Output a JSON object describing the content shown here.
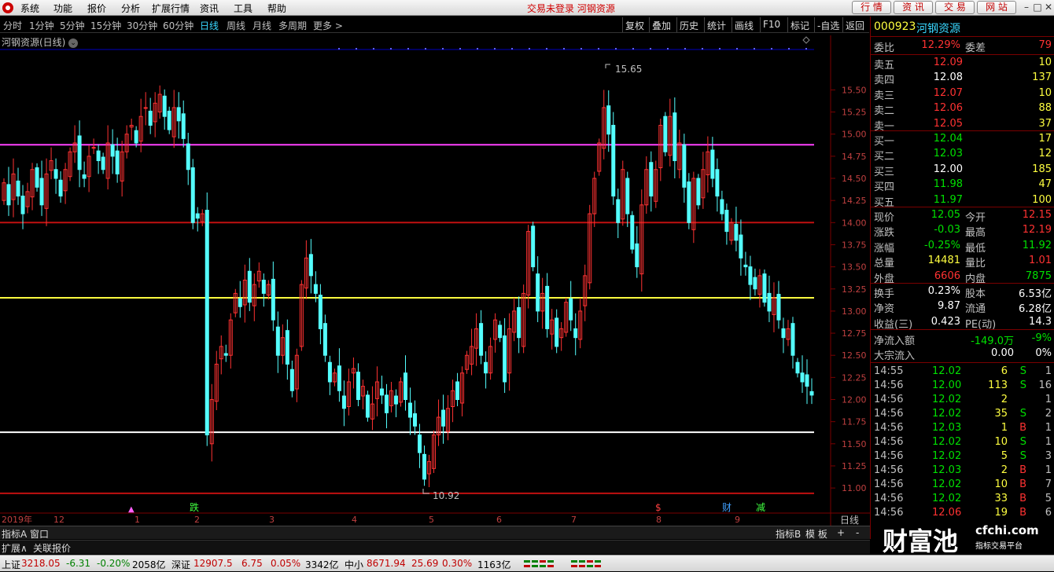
{
  "titlebar": {
    "menus": [
      "系统",
      "功能",
      "报价",
      "分析",
      "扩展行情",
      "资讯",
      "工具",
      "帮助"
    ],
    "center_text": "交易未登录  河钢资源",
    "buttons": [
      "行 情",
      "资 讯",
      "交 易",
      "网 站"
    ]
  },
  "periods": [
    "分时",
    "1分钟",
    "5分钟",
    "15分钟",
    "30分钟",
    "60分钟",
    "日线",
    "周线",
    "月线",
    "多周期",
    "更多 >"
  ],
  "active_period": "日线",
  "right_tools": [
    "复权",
    "叠加",
    "历史",
    "统计",
    "画线",
    "F10",
    "标记",
    "-自选",
    "返回"
  ],
  "chart": {
    "title": "河钢资源(日线)",
    "high_label": "15.65",
    "low_label": "10.92",
    "year_label": "2019年",
    "period_label": "日线",
    "months": [
      "12",
      "1",
      "2",
      "3",
      "4",
      "5",
      "6",
      "7",
      "8",
      "9"
    ],
    "markers": [
      "跌",
      "$",
      "财",
      "减"
    ],
    "colors": {
      "up": "#ff3232",
      "down": "#54ffff",
      "magenta": "#ff40ff",
      "yellow": "#ffff40",
      "red": "#c01010",
      "white": "#ffffff"
    }
  },
  "chart_data": {
    "type": "candlestick",
    "y_ticks": [
      "15.50",
      "15.25",
      "15.00",
      "14.75",
      "14.50",
      "14.25",
      "14.00",
      "13.75",
      "13.50",
      "13.25",
      "13.00",
      "12.75",
      "12.50",
      "12.25",
      "12.00",
      "11.75",
      "11.50",
      "11.25",
      "11.00"
    ],
    "ylim": [
      10.85,
      15.85
    ],
    "hlines": [
      {
        "value": 14.88,
        "color": "magenta"
      },
      {
        "value": 14.0,
        "color": "red"
      },
      {
        "value": 13.15,
        "color": "yellow"
      },
      {
        "value": 11.63,
        "color": "white"
      },
      {
        "value": 10.94,
        "color": "red"
      }
    ],
    "closes": [
      14.45,
      14.2,
      14.55,
      14.3,
      14.1,
      14.35,
      14.6,
      14.4,
      14.2,
      14.55,
      14.7,
      14.5,
      14.3,
      14.6,
      14.8,
      14.9,
      14.6,
      14.5,
      14.75,
      14.85,
      14.7,
      14.6,
      14.9,
      14.75,
      14.55,
      14.8,
      15.0,
      15.1,
      14.9,
      15.2,
      15.3,
      15.1,
      15.35,
      15.45,
      15.2,
      15.05,
      15.3,
      15.15,
      14.95,
      14.6,
      14.0,
      14.05,
      14.1,
      11.6,
      12.0,
      12.4,
      12.6,
      12.5,
      12.9,
      13.2,
      13.05,
      13.35,
      13.1,
      13.3,
      13.45,
      13.2,
      13.3,
      12.9,
      12.5,
      12.7,
      12.4,
      12.1,
      12.5,
      13.3,
      13.6,
      13.4,
      13.2,
      12.8,
      12.5,
      12.2,
      12.3,
      12.1,
      11.9,
      12.2,
      12.35,
      12.0,
      12.15,
      11.8,
      11.95,
      12.2,
      12.05,
      11.85,
      12.1,
      11.95,
      12.2,
      12.0,
      11.8,
      11.7,
      11.4,
      11.1,
      11.3,
      11.6,
      11.8,
      11.7,
      11.9,
      12.1,
      12.0,
      12.3,
      12.5,
      12.6,
      12.8,
      12.5,
      12.3,
      12.6,
      12.9,
      12.7,
      12.2,
      12.8,
      13.0,
      12.7,
      13.2,
      13.9,
      13.5,
      13.0,
      13.2,
      12.8,
      12.9,
      12.6,
      12.8,
      13.1,
      12.9,
      12.7,
      13.0,
      13.4,
      14.1,
      14.5,
      14.9,
      15.3,
      15.0,
      14.3,
      14.0,
      14.6,
      14.1,
      13.7,
      13.5,
      14.2,
      14.6,
      14.3,
      14.6,
      15.1,
      14.8,
      15.2,
      14.7,
      14.9,
      14.4,
      14.0,
      14.5,
      14.2,
      14.6,
      14.8,
      14.5,
      14.3,
      14.1,
      13.9,
      14.0,
      13.8,
      13.6,
      13.5,
      13.3,
      13.25,
      13.4,
      13.1,
      13.0,
      13.15,
      12.9,
      12.7,
      12.8,
      12.5,
      12.3,
      12.2,
      12.15,
      12.05
    ]
  },
  "quote": {
    "code": "000923",
    "name": "河钢资源",
    "weibi_label": "委比",
    "weibi_value": "12.29%",
    "weicha_label": "委差",
    "weicha_value": "79",
    "asks": [
      {
        "label": "卖五",
        "price": "12.09",
        "vol": "10"
      },
      {
        "label": "卖四",
        "price": "12.08",
        "vol": "137"
      },
      {
        "label": "卖三",
        "price": "12.07",
        "vol": "10"
      },
      {
        "label": "卖二",
        "price": "12.06",
        "vol": "88"
      },
      {
        "label": "卖一",
        "price": "12.05",
        "vol": "37"
      }
    ],
    "bids": [
      {
        "label": "买一",
        "price": "12.04",
        "vol": "17"
      },
      {
        "label": "买二",
        "price": "12.03",
        "vol": "12"
      },
      {
        "label": "买三",
        "price": "12.00",
        "vol": "185"
      },
      {
        "label": "买四",
        "price": "11.98",
        "vol": "47"
      },
      {
        "label": "买五",
        "price": "11.97",
        "vol": "100"
      }
    ],
    "stats": [
      {
        "l1": "现价",
        "v1": "12.05",
        "c1": "#00e000",
        "l2": "今开",
        "v2": "12.15",
        "c2": "#ff3232"
      },
      {
        "l1": "涨跌",
        "v1": "-0.03",
        "c1": "#00e000",
        "l2": "最高",
        "v2": "12.19",
        "c2": "#ff3232"
      },
      {
        "l1": "涨幅",
        "v1": "-0.25%",
        "c1": "#00e000",
        "l2": "最低",
        "v2": "11.92",
        "c2": "#00e000"
      },
      {
        "l1": "总量",
        "v1": "14481",
        "c1": "#ffff40",
        "l2": "量比",
        "v2": "1.01",
        "c2": "#ff3232"
      },
      {
        "l1": "外盘",
        "v1": "6606",
        "c1": "#ff3232",
        "l2": "内盘",
        "v2": "7875",
        "c2": "#00e000"
      }
    ],
    "stats2": [
      {
        "l1": "换手",
        "v1": "0.23%",
        "l2": "股本",
        "v2": "6.53亿"
      },
      {
        "l1": "净资",
        "v1": "9.87",
        "l2": "流通",
        "v2": "6.28亿"
      },
      {
        "l1": "收益(三)",
        "v1": "0.423",
        "l2": "PE(动)",
        "v2": "14.3"
      }
    ],
    "net_inflow_label": "净流入额",
    "net_inflow_value": "-149.0万",
    "net_inflow_pct": "-9%",
    "block_label": "大宗流入",
    "block_value": "0.00",
    "block_pct": "0%",
    "ticks": [
      {
        "t": "14:55",
        "p": "12.02",
        "v": "6",
        "bs": "S",
        "n": "1"
      },
      {
        "t": "14:56",
        "p": "12.00",
        "v": "113",
        "bs": "S",
        "n": "16"
      },
      {
        "t": "14:56",
        "p": "12.02",
        "v": "2",
        "bs": "",
        "n": "1"
      },
      {
        "t": "14:56",
        "p": "12.02",
        "v": "35",
        "bs": "S",
        "n": "2"
      },
      {
        "t": "14:56",
        "p": "12.03",
        "v": "1",
        "bs": "B",
        "n": "1"
      },
      {
        "t": "14:56",
        "p": "12.02",
        "v": "10",
        "bs": "S",
        "n": "1"
      },
      {
        "t": "14:56",
        "p": "12.02",
        "v": "5",
        "bs": "S",
        "n": "3"
      },
      {
        "t": "14:56",
        "p": "12.03",
        "v": "2",
        "bs": "B",
        "n": "1"
      },
      {
        "t": "14:56",
        "p": "12.02",
        "v": "10",
        "bs": "B",
        "n": "7"
      },
      {
        "t": "14:56",
        "p": "12.02",
        "v": "33",
        "bs": "B",
        "n": "5"
      },
      {
        "t": "14:56",
        "p": "12.06",
        "v": "19",
        "bs": "B",
        "n": "6"
      }
    ]
  },
  "bottom": {
    "tabs1": [
      "指标A",
      "窗口"
    ],
    "tabs1_right": [
      "指标B",
      "模 板",
      "+",
      "-"
    ],
    "tabs2": [
      "扩展∧",
      "关联报价"
    ],
    "watermark_main": "财富池",
    "watermark_url": "cfchi.com",
    "watermark_sub": "指标交易平台"
  },
  "status": {
    "sh_label": "上证",
    "sh_price": "3218.05",
    "sh_chg": "-6.31",
    "sh_pct": "-0.20%",
    "sh_amt": "2058亿",
    "sz_label": "深证",
    "sz_price": "12907.5",
    "sz_chg": "6.75",
    "sz_pct": "0.05%",
    "sz_amt": "3342亿",
    "zx_label": "中小",
    "zx_price": "8671.94",
    "zx_chg": "25.69",
    "zx_pct": "0.30%",
    "zx_amt": "1163亿"
  }
}
